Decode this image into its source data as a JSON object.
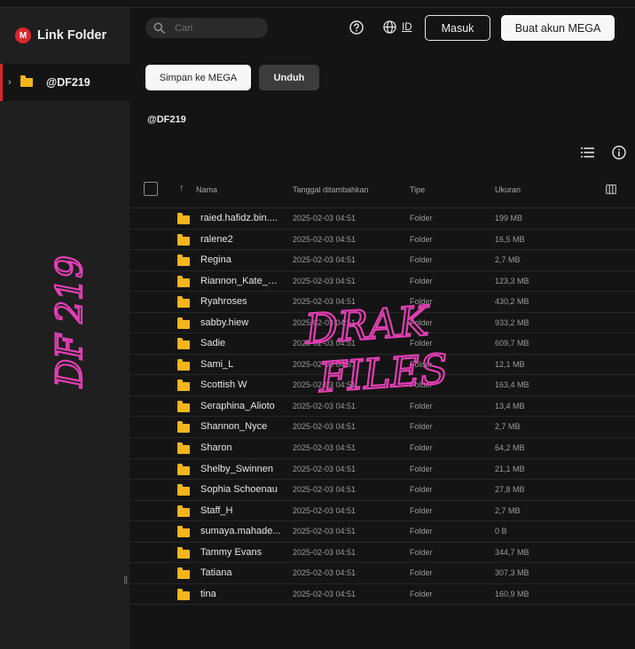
{
  "app": {
    "logo_letter": "M",
    "title": "Link Folder"
  },
  "sidebar": {
    "items": [
      {
        "label": "@DF219",
        "icon": "folder-icon"
      }
    ]
  },
  "header": {
    "search_placeholder": "Cari",
    "language_code": "ID",
    "login_label": "Masuk",
    "signup_label": "Buat akun MEGA"
  },
  "toolbar": {
    "save_label": "Simpan ke MEGA",
    "download_label": "Unduh"
  },
  "breadcrumb": "@DF219",
  "table": {
    "columns": [
      "Nama",
      "Tanggal ditambahkan",
      "Tipe",
      "Ukuran"
    ],
    "rows": [
      {
        "name": "raied.hafidz.bin....",
        "date": "2025-02-03 04:51",
        "type": "Folder",
        "size": "199 MB"
      },
      {
        "name": "ralene2",
        "date": "2025-02-03 04:51",
        "type": "Folder",
        "size": "16,5 MB"
      },
      {
        "name": "Regina",
        "date": "2025-02-03 04:51",
        "type": "Folder",
        "size": "2,7 MB"
      },
      {
        "name": "Riannon_Kate_M...",
        "date": "2025-02-03 04:51",
        "type": "Folder",
        "size": "123,3 MB"
      },
      {
        "name": "Ryahroses",
        "date": "2025-02-03 04:51",
        "type": "Folder",
        "size": "430,2 MB"
      },
      {
        "name": "sabby.hiew",
        "date": "2025-02-03 04:51",
        "type": "Folder",
        "size": "933,2 MB"
      },
      {
        "name": "Sadie",
        "date": "2025-02-03 04:51",
        "type": "Folder",
        "size": "609,7 MB"
      },
      {
        "name": "Sami_L",
        "date": "2025-02-03 04:51",
        "type": "Folder",
        "size": "12,1 MB"
      },
      {
        "name": "Scottish W",
        "date": "2025-02-03 04:51",
        "type": "Folder",
        "size": "163,4 MB"
      },
      {
        "name": "Seraphina_Alioto",
        "date": "2025-02-03 04:51",
        "type": "Folder",
        "size": "13,4 MB"
      },
      {
        "name": "Shannon_Nyce",
        "date": "2025-02-03 04:51",
        "type": "Folder",
        "size": "2,7 MB"
      },
      {
        "name": "Sharon",
        "date": "2025-02-03 04:51",
        "type": "Folder",
        "size": "64,2 MB"
      },
      {
        "name": "Shelby_Swinnen",
        "date": "2025-02-03 04:51",
        "type": "Folder",
        "size": "21,1 MB"
      },
      {
        "name": "Sophia Schoenau",
        "date": "2025-02-03 04:51",
        "type": "Folder",
        "size": "27,8 MB"
      },
      {
        "name": "Staff_H",
        "date": "2025-02-03 04:51",
        "type": "Folder",
        "size": "2,7 MB"
      },
      {
        "name": "sumaya.mahade...",
        "date": "2025-02-03 04:51",
        "type": "Folder",
        "size": "0 B"
      },
      {
        "name": "Tammy Evans",
        "date": "2025-02-03 04:51",
        "type": "Folder",
        "size": "344,7 MB"
      },
      {
        "name": "Tatiana",
        "date": "2025-02-03 04:51",
        "type": "Folder",
        "size": "307,3 MB"
      },
      {
        "name": "tina",
        "date": "2025-02-03 04:51",
        "type": "Folder",
        "size": "160,9 MB"
      }
    ]
  },
  "overlay": {
    "left_text": "DF 219",
    "center_text_line1": "DRAK",
    "center_text_line2": "FILES"
  },
  "colors": {
    "accent": "#d9272e",
    "folder": "#f5b51b",
    "doodle": "#e23fb3"
  }
}
